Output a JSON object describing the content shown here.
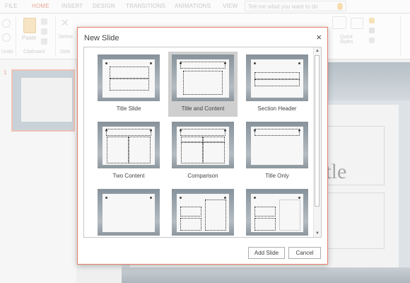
{
  "ribbon_tabs": [
    "FILE",
    "HOME",
    "INSERT",
    "DESIGN",
    "TRANSITIONS",
    "ANIMATIONS",
    "VIEW"
  ],
  "active_tab": "HOME",
  "tell_me_placeholder": "Tell me what you want to do",
  "ribbon": {
    "undo_label": "Undo",
    "paste_label": "Paste",
    "clipboard_group": "Clipboard",
    "delete_label": "Delete",
    "quick_styles_label": "Quick Styles",
    "delete_group_short": "Dele"
  },
  "slides_pane": {
    "slide_number": "1"
  },
  "slide_canvas": {
    "title_placeholder_visible": "itle"
  },
  "dialog": {
    "title": "New Slide",
    "close_glyph": "×",
    "layouts": [
      {
        "name": "Title Slide",
        "selected": false
      },
      {
        "name": "Title and Content",
        "selected": true
      },
      {
        "name": "Section Header",
        "selected": false
      },
      {
        "name": "Two Content",
        "selected": false
      },
      {
        "name": "Comparison",
        "selected": false
      },
      {
        "name": "Title Only",
        "selected": false
      },
      {
        "name": "",
        "selected": false
      },
      {
        "name": "",
        "selected": false
      },
      {
        "name": "",
        "selected": false
      }
    ],
    "add_button": "Add Slide",
    "cancel_button": "Cancel",
    "scroll_up_glyph": "▲",
    "scroll_down_glyph": "▼"
  },
  "colors": {
    "accent": "#e4816a",
    "selected_tile": "#cfcfcf"
  }
}
